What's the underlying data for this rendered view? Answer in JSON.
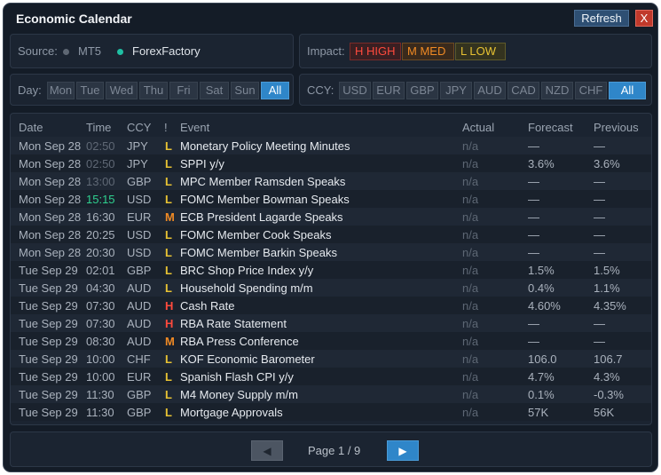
{
  "window": {
    "title": "Economic Calendar",
    "refresh_label": "Refresh",
    "close_label": "X"
  },
  "source": {
    "label": "Source:",
    "options": [
      {
        "name": "MT5",
        "dot_color": "#5e6773",
        "text_color": "#8e98a6"
      },
      {
        "name": "ForexFactory",
        "dot_color": "#1fbfa3",
        "text_color": "#e3e8ee"
      }
    ]
  },
  "impact": {
    "label": "Impact:",
    "options": [
      {
        "label": "H  HIGH",
        "color": "#ff4a3d",
        "bg": "#3a1f22",
        "border": "#7a2a28"
      },
      {
        "label": "M  MED",
        "color": "#f08a24",
        "bg": "#3a2a1c",
        "border": "#6e4a22"
      },
      {
        "label": "L  LOW",
        "color": "#e7c233",
        "bg": "#34331f",
        "border": "#5f5a2a"
      }
    ]
  },
  "day_filter": {
    "label": "Day:",
    "options": [
      "Mon",
      "Tue",
      "Wed",
      "Thu",
      "Fri",
      "Sat",
      "Sun",
      "All"
    ],
    "selected": "All"
  },
  "ccy_filter": {
    "label": "CCY:",
    "options": [
      "USD",
      "EUR",
      "GBP",
      "JPY",
      "AUD",
      "CAD",
      "NZD",
      "CHF",
      "All"
    ],
    "selected": "All"
  },
  "table": {
    "headers": {
      "date": "Date",
      "time": "Time",
      "ccy": "CCY",
      "impact": "!",
      "event": "Event",
      "actual": "Actual",
      "forecast": "Forecast",
      "previous": "Previous"
    },
    "rows": [
      {
        "date": "Mon Sep 28",
        "time": "02:50",
        "time_state": "past",
        "ccy": "JPY",
        "impact": "L",
        "event": "Monetary Policy Meeting Minutes",
        "actual": "n/a",
        "forecast": "—",
        "previous": "—"
      },
      {
        "date": "Mon Sep 28",
        "time": "02:50",
        "time_state": "past",
        "ccy": "JPY",
        "impact": "L",
        "event": "SPPI y/y",
        "actual": "n/a",
        "forecast": "3.6%",
        "previous": "3.6%"
      },
      {
        "date": "Mon Sep 28",
        "time": "13:00",
        "time_state": "past",
        "ccy": "GBP",
        "impact": "L",
        "event": "MPC Member Ramsden Speaks",
        "actual": "n/a",
        "forecast": "—",
        "previous": "—"
      },
      {
        "date": "Mon Sep 28",
        "time": "15:15",
        "time_state": "next",
        "ccy": "USD",
        "impact": "L",
        "event": "FOMC Member Bowman Speaks",
        "actual": "n/a",
        "forecast": "—",
        "previous": "—"
      },
      {
        "date": "Mon Sep 28",
        "time": "16:30",
        "time_state": "upcoming",
        "ccy": "EUR",
        "impact": "M",
        "event": "ECB President Lagarde Speaks",
        "actual": "n/a",
        "forecast": "—",
        "previous": "—"
      },
      {
        "date": "Mon Sep 28",
        "time": "20:25",
        "time_state": "upcoming",
        "ccy": "USD",
        "impact": "L",
        "event": "FOMC Member Cook Speaks",
        "actual": "n/a",
        "forecast": "—",
        "previous": "—"
      },
      {
        "date": "Mon Sep 28",
        "time": "20:30",
        "time_state": "upcoming",
        "ccy": "USD",
        "impact": "L",
        "event": "FOMC Member Barkin Speaks",
        "actual": "n/a",
        "forecast": "—",
        "previous": "—"
      },
      {
        "date": "Tue Sep 29",
        "time": "02:01",
        "time_state": "upcoming",
        "ccy": "GBP",
        "impact": "L",
        "event": "BRC Shop Price Index y/y",
        "actual": "n/a",
        "forecast": "1.5%",
        "previous": "1.5%"
      },
      {
        "date": "Tue Sep 29",
        "time": "04:30",
        "time_state": "upcoming",
        "ccy": "AUD",
        "impact": "L",
        "event": "Household Spending m/m",
        "actual": "n/a",
        "forecast": "0.4%",
        "previous": "1.1%"
      },
      {
        "date": "Tue Sep 29",
        "time": "07:30",
        "time_state": "upcoming",
        "ccy": "AUD",
        "impact": "H",
        "event": "Cash Rate",
        "actual": "n/a",
        "forecast": "4.60%",
        "previous": "4.35%"
      },
      {
        "date": "Tue Sep 29",
        "time": "07:30",
        "time_state": "upcoming",
        "ccy": "AUD",
        "impact": "H",
        "event": "RBA Rate Statement",
        "actual": "n/a",
        "forecast": "—",
        "previous": "—"
      },
      {
        "date": "Tue Sep 29",
        "time": "08:30",
        "time_state": "upcoming",
        "ccy": "AUD",
        "impact": "M",
        "event": "RBA Press Conference",
        "actual": "n/a",
        "forecast": "—",
        "previous": "—"
      },
      {
        "date": "Tue Sep 29",
        "time": "10:00",
        "time_state": "upcoming",
        "ccy": "CHF",
        "impact": "L",
        "event": "KOF Economic Barometer",
        "actual": "n/a",
        "forecast": "106.0",
        "previous": "106.7"
      },
      {
        "date": "Tue Sep 29",
        "time": "10:00",
        "time_state": "upcoming",
        "ccy": "EUR",
        "impact": "L",
        "event": "Spanish Flash CPI y/y",
        "actual": "n/a",
        "forecast": "4.7%",
        "previous": "4.3%"
      },
      {
        "date": "Tue Sep 29",
        "time": "11:30",
        "time_state": "upcoming",
        "ccy": "GBP",
        "impact": "L",
        "event": "M4 Money Supply m/m",
        "actual": "n/a",
        "forecast": "0.1%",
        "previous": "-0.3%"
      },
      {
        "date": "Tue Sep 29",
        "time": "11:30",
        "time_state": "upcoming",
        "ccy": "GBP",
        "impact": "L",
        "event": "Mortgage Approvals",
        "actual": "n/a",
        "forecast": "57K",
        "previous": "56K"
      }
    ]
  },
  "impact_colors": {
    "H": "#ff4a3d",
    "M": "#f08a24",
    "L": "#e7c233"
  },
  "time_colors": {
    "past": "#5f6875",
    "next": "#2fd08f",
    "upcoming": "#aab2bd"
  },
  "pagination": {
    "prev_icon": "◀",
    "next_icon": "▶",
    "page_info": "Page 1 / 9"
  }
}
